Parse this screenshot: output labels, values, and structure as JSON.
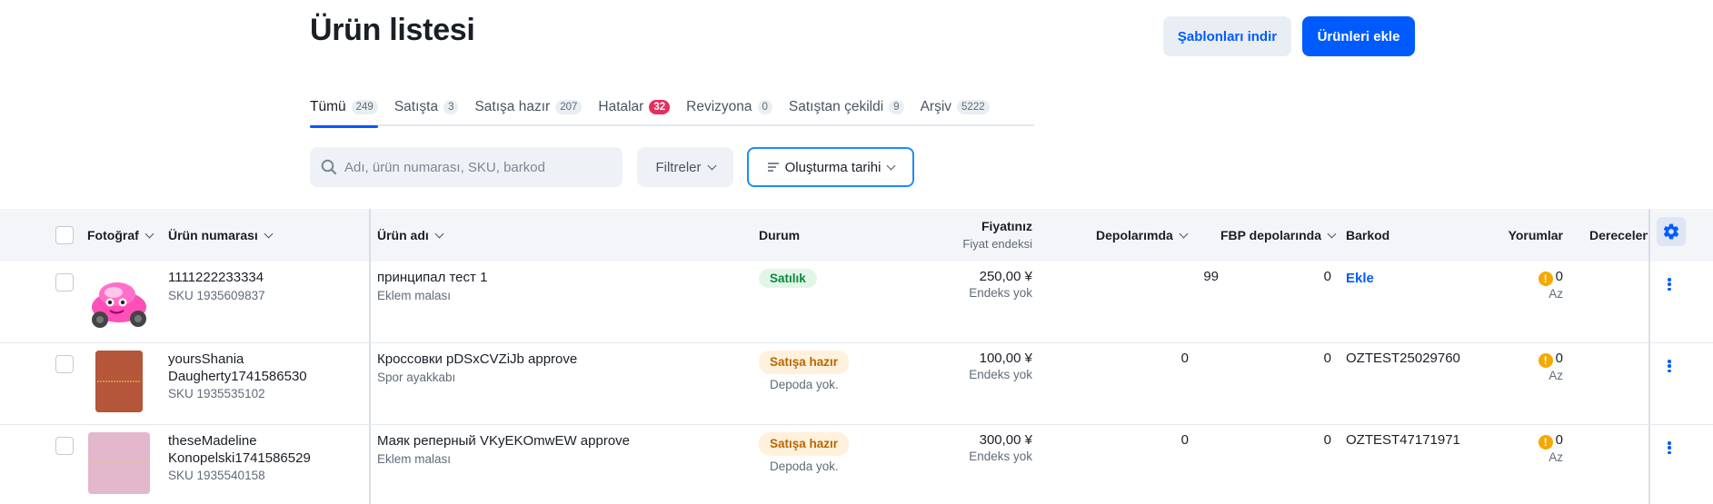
{
  "header": {
    "title": "Ürün listesi",
    "download_templates_label": "Şablonları indir",
    "add_products_label": "Ürünleri ekle"
  },
  "tabs": [
    {
      "label": "Tümü",
      "count": "249",
      "active": true
    },
    {
      "label": "Satışta",
      "count": "3"
    },
    {
      "label": "Satışa hazır",
      "count": "207"
    },
    {
      "label": "Hatalar",
      "count": "32",
      "danger": true
    },
    {
      "label": "Revizyona",
      "count": "0"
    },
    {
      "label": "Satıştan çekildi",
      "count": "9"
    },
    {
      "label": "Arşiv",
      "count": "5222"
    }
  ],
  "toolbar": {
    "search_placeholder": "Adı, ürün numarası, SKU, barkod",
    "filters_label": "Filtreler",
    "sort_label": "Oluşturma tarihi"
  },
  "columns": {
    "photo": "Fotoğraf",
    "product_number": "Ürün numarası",
    "product_name": "Ürün adı",
    "status": "Durum",
    "price": "Fiyatınız",
    "price_sub": "Fiyat endeksi",
    "warehouses": "Depolarımda",
    "fbp_warehouses": "FBP depolarında",
    "barcode": "Barkod",
    "reviews": "Yorumlar",
    "rating": "Derecelen"
  },
  "rows": [
    {
      "number": "1111222233334",
      "sku": "SKU 1935609837",
      "name": "принципал тест 1",
      "category": "Eklem malası",
      "status": "Satılık",
      "status_note": "",
      "price": "250,00 ¥",
      "price_index": "Endeks yok",
      "warehouses": "99",
      "fbp": "0",
      "barcode": "Ekle",
      "reviews": "0",
      "reviews_note": "Az"
    },
    {
      "number_line1": "yoursShania",
      "number_line2": "Daugherty1741586530",
      "sku": "SKU 1935535102",
      "name": "Кроссовки pDSxCVZiJb approve",
      "category": "Spor ayakkabı",
      "status": "Satışa hazır",
      "status_note": "Depoda yok.",
      "price": "100,00 ¥",
      "price_index": "Endeks yok",
      "warehouses": "0",
      "fbp": "0",
      "barcode": "OZTEST25029760",
      "reviews": "0",
      "reviews_note": "Az"
    },
    {
      "number_line1": "theseMadeline",
      "number_line2": "Konopelski1741586529",
      "sku": "SKU 1935540158",
      "name": "Маяк реперный VKyEKOmwEW approve",
      "category": "Eklem malası",
      "status": "Satışa hazır",
      "status_note": "Depoda yok.",
      "price": "300,00 ¥",
      "price_index": "Endeks yok",
      "warehouses": "0",
      "fbp": "0",
      "barcode": "OZTEST47171971",
      "reviews": "0",
      "reviews_note": "Az"
    }
  ],
  "colors": {
    "accent": "#005bff",
    "danger": "#e62e5c",
    "success_bg": "#e2f6e8",
    "warning_bg": "#fff1dc",
    "warning_icon": "#f5a900"
  }
}
